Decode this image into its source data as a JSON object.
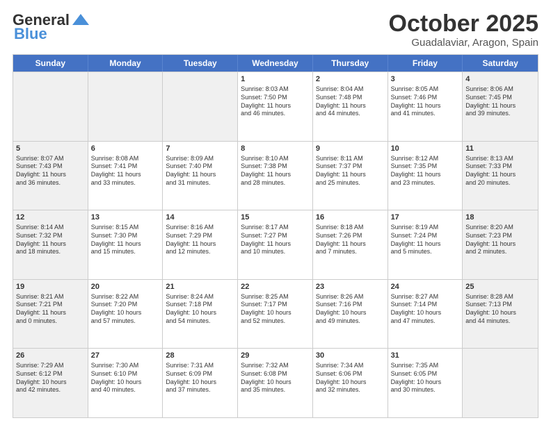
{
  "logo": {
    "line1": "General",
    "line2": "Blue"
  },
  "title": "October 2025",
  "location": "Guadalaviar, Aragon, Spain",
  "days_of_week": [
    "Sunday",
    "Monday",
    "Tuesday",
    "Wednesday",
    "Thursday",
    "Friday",
    "Saturday"
  ],
  "weeks": [
    [
      {
        "day": "",
        "text": "",
        "shade": true
      },
      {
        "day": "",
        "text": "",
        "shade": true
      },
      {
        "day": "",
        "text": "",
        "shade": true
      },
      {
        "day": "1",
        "text": "Sunrise: 8:03 AM\nSunset: 7:50 PM\nDaylight: 11 hours\nand 46 minutes.",
        "shade": false
      },
      {
        "day": "2",
        "text": "Sunrise: 8:04 AM\nSunset: 7:48 PM\nDaylight: 11 hours\nand 44 minutes.",
        "shade": false
      },
      {
        "day": "3",
        "text": "Sunrise: 8:05 AM\nSunset: 7:46 PM\nDaylight: 11 hours\nand 41 minutes.",
        "shade": false
      },
      {
        "day": "4",
        "text": "Sunrise: 8:06 AM\nSunset: 7:45 PM\nDaylight: 11 hours\nand 39 minutes.",
        "shade": true
      }
    ],
    [
      {
        "day": "5",
        "text": "Sunrise: 8:07 AM\nSunset: 7:43 PM\nDaylight: 11 hours\nand 36 minutes.",
        "shade": true
      },
      {
        "day": "6",
        "text": "Sunrise: 8:08 AM\nSunset: 7:41 PM\nDaylight: 11 hours\nand 33 minutes.",
        "shade": false
      },
      {
        "day": "7",
        "text": "Sunrise: 8:09 AM\nSunset: 7:40 PM\nDaylight: 11 hours\nand 31 minutes.",
        "shade": false
      },
      {
        "day": "8",
        "text": "Sunrise: 8:10 AM\nSunset: 7:38 PM\nDaylight: 11 hours\nand 28 minutes.",
        "shade": false
      },
      {
        "day": "9",
        "text": "Sunrise: 8:11 AM\nSunset: 7:37 PM\nDaylight: 11 hours\nand 25 minutes.",
        "shade": false
      },
      {
        "day": "10",
        "text": "Sunrise: 8:12 AM\nSunset: 7:35 PM\nDaylight: 11 hours\nand 23 minutes.",
        "shade": false
      },
      {
        "day": "11",
        "text": "Sunrise: 8:13 AM\nSunset: 7:33 PM\nDaylight: 11 hours\nand 20 minutes.",
        "shade": true
      }
    ],
    [
      {
        "day": "12",
        "text": "Sunrise: 8:14 AM\nSunset: 7:32 PM\nDaylight: 11 hours\nand 18 minutes.",
        "shade": true
      },
      {
        "day": "13",
        "text": "Sunrise: 8:15 AM\nSunset: 7:30 PM\nDaylight: 11 hours\nand 15 minutes.",
        "shade": false
      },
      {
        "day": "14",
        "text": "Sunrise: 8:16 AM\nSunset: 7:29 PM\nDaylight: 11 hours\nand 12 minutes.",
        "shade": false
      },
      {
        "day": "15",
        "text": "Sunrise: 8:17 AM\nSunset: 7:27 PM\nDaylight: 11 hours\nand 10 minutes.",
        "shade": false
      },
      {
        "day": "16",
        "text": "Sunrise: 8:18 AM\nSunset: 7:26 PM\nDaylight: 11 hours\nand 7 minutes.",
        "shade": false
      },
      {
        "day": "17",
        "text": "Sunrise: 8:19 AM\nSunset: 7:24 PM\nDaylight: 11 hours\nand 5 minutes.",
        "shade": false
      },
      {
        "day": "18",
        "text": "Sunrise: 8:20 AM\nSunset: 7:23 PM\nDaylight: 11 hours\nand 2 minutes.",
        "shade": true
      }
    ],
    [
      {
        "day": "19",
        "text": "Sunrise: 8:21 AM\nSunset: 7:21 PM\nDaylight: 11 hours\nand 0 minutes.",
        "shade": true
      },
      {
        "day": "20",
        "text": "Sunrise: 8:22 AM\nSunset: 7:20 PM\nDaylight: 10 hours\nand 57 minutes.",
        "shade": false
      },
      {
        "day": "21",
        "text": "Sunrise: 8:24 AM\nSunset: 7:18 PM\nDaylight: 10 hours\nand 54 minutes.",
        "shade": false
      },
      {
        "day": "22",
        "text": "Sunrise: 8:25 AM\nSunset: 7:17 PM\nDaylight: 10 hours\nand 52 minutes.",
        "shade": false
      },
      {
        "day": "23",
        "text": "Sunrise: 8:26 AM\nSunset: 7:16 PM\nDaylight: 10 hours\nand 49 minutes.",
        "shade": false
      },
      {
        "day": "24",
        "text": "Sunrise: 8:27 AM\nSunset: 7:14 PM\nDaylight: 10 hours\nand 47 minutes.",
        "shade": false
      },
      {
        "day": "25",
        "text": "Sunrise: 8:28 AM\nSunset: 7:13 PM\nDaylight: 10 hours\nand 44 minutes.",
        "shade": true
      }
    ],
    [
      {
        "day": "26",
        "text": "Sunrise: 7:29 AM\nSunset: 6:12 PM\nDaylight: 10 hours\nand 42 minutes.",
        "shade": true
      },
      {
        "day": "27",
        "text": "Sunrise: 7:30 AM\nSunset: 6:10 PM\nDaylight: 10 hours\nand 40 minutes.",
        "shade": false
      },
      {
        "day": "28",
        "text": "Sunrise: 7:31 AM\nSunset: 6:09 PM\nDaylight: 10 hours\nand 37 minutes.",
        "shade": false
      },
      {
        "day": "29",
        "text": "Sunrise: 7:32 AM\nSunset: 6:08 PM\nDaylight: 10 hours\nand 35 minutes.",
        "shade": false
      },
      {
        "day": "30",
        "text": "Sunrise: 7:34 AM\nSunset: 6:06 PM\nDaylight: 10 hours\nand 32 minutes.",
        "shade": false
      },
      {
        "day": "31",
        "text": "Sunrise: 7:35 AM\nSunset: 6:05 PM\nDaylight: 10 hours\nand 30 minutes.",
        "shade": false
      },
      {
        "day": "",
        "text": "",
        "shade": true
      }
    ]
  ]
}
